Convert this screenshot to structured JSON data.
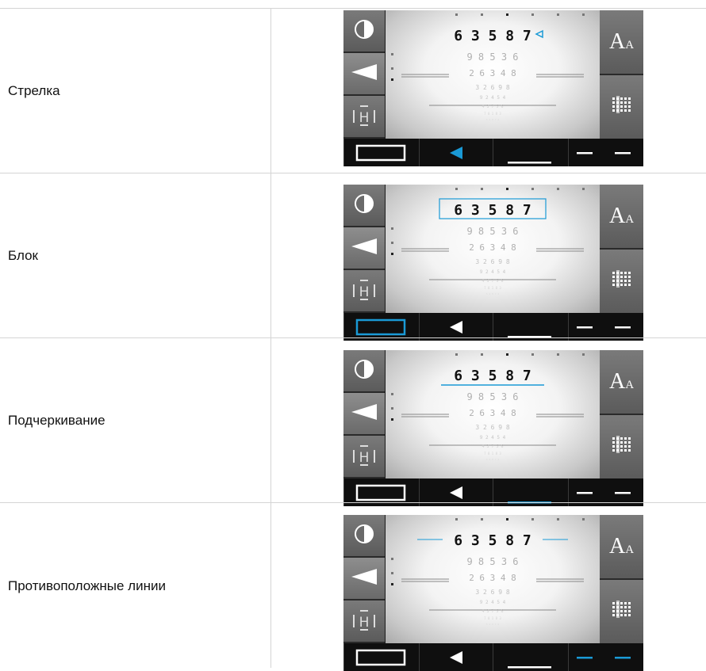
{
  "rows": [
    {
      "label": "Стрелка",
      "mode": "arrow"
    },
    {
      "label": "Блок",
      "mode": "block"
    },
    {
      "label": "Подчеркивание",
      "mode": "underline"
    },
    {
      "label": "Противоположные линии",
      "mode": "opposite-lines"
    }
  ],
  "chart": {
    "line1": "6 3 5 8 7",
    "line2": "9 8 5 3 6",
    "line3": "2 6 3 4 8",
    "line4": "3 2 6 9 8",
    "line5": "9 2 4 5 4",
    "line6": "4 3 7 5 6",
    "line7": "7 8 1 8 3",
    "line8": "5 2 9 7 4"
  },
  "buttons": {
    "contrast_icon": "contrast-icon",
    "arrow_icon": "arrow-left-icon",
    "h_icon": "h-marker-icon",
    "font_size_label_big": "A",
    "font_size_label_small": "A",
    "grid_icon": "grid-icon"
  },
  "colors": {
    "accent": "#1a9ad6",
    "panel": "#6b6b6b",
    "bar": "#111111"
  }
}
